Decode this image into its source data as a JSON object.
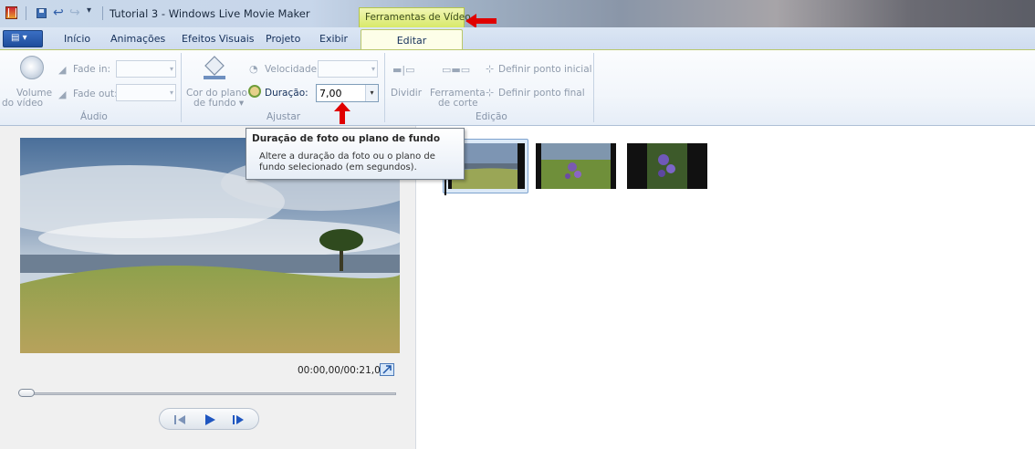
{
  "window": {
    "title": "Tutorial 3 - Windows Live Movie Maker",
    "context_tab": "Ferramentas de Vídeo"
  },
  "tabs": [
    {
      "label": "Início"
    },
    {
      "label": "Animações"
    },
    {
      "label": "Efeitos Visuais"
    },
    {
      "label": "Projeto"
    },
    {
      "label": "Exibir"
    },
    {
      "label": "Editar",
      "active": true
    }
  ],
  "ribbon": {
    "audio": {
      "group_label": "Áudio",
      "volume_label_1": "Volume",
      "volume_label_2": "do vídeo",
      "fade_in_label": "Fade in:",
      "fade_out_label": "Fade out:",
      "fade_in_value": "",
      "fade_out_value": ""
    },
    "adjust": {
      "group_label": "Ajustar",
      "bgcolor_label_1": "Cor do plano",
      "bgcolor_label_2": "de fundo ▾",
      "speed_label": "Velocidade:",
      "speed_value": "",
      "duration_label": "Duração:",
      "duration_value": "7,00"
    },
    "editing": {
      "group_label": "Edição",
      "split_label": "Dividir",
      "trim_label_1": "Ferramenta",
      "trim_label_2": "de corte",
      "set_start": "Definir ponto inicial",
      "set_end": "Definir ponto final"
    }
  },
  "tooltip": {
    "title": "Duração de foto ou plano de fundo",
    "body": "Altere a duração da foto ou o plano de fundo selecionado (em segundos)."
  },
  "preview": {
    "timecode": "00:00,00/00:21,00",
    "seek_position": 0.0
  },
  "storyboard": {
    "clips": [
      {
        "selected": true
      },
      {
        "selected": false
      },
      {
        "selected": false
      }
    ]
  },
  "colors": {
    "accent_context": "#d8e96a",
    "annotation_arrow": "#e00000",
    "file_button": "#1f4d9b"
  }
}
